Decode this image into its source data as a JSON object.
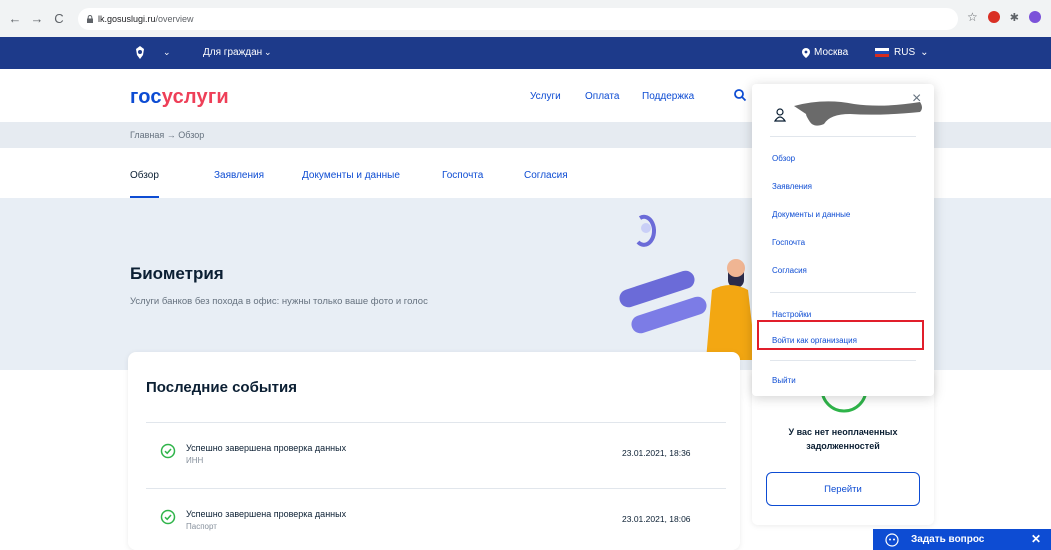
{
  "browser": {
    "url_host": "lk.gosuslugi.ru",
    "url_path": "/overview",
    "back": "←",
    "forward": "→",
    "reload": "C"
  },
  "topbar": {
    "citizens": "Для граждан",
    "city": "Москва",
    "lang": "RUS"
  },
  "header": {
    "logo_a": "гос",
    "logo_b": "услуги",
    "nav": [
      "Услуги",
      "Оплата",
      "Поддержка"
    ]
  },
  "breadcrumbs": "Главная → Обзор",
  "tabs": [
    "Обзор",
    "Заявления",
    "Документы и данные",
    "Госпочта",
    "Согласия"
  ],
  "hero": {
    "title": "Биометрия",
    "subtitle": "Услуги банков без похода в офис: нужны только ваше фото и голос"
  },
  "events": {
    "title": "Последние события",
    "items": [
      {
        "title": "Успешно завершена проверка данных",
        "sub": "ИНН",
        "date": "23.01.2021, 18:36"
      },
      {
        "title": "Успешно завершена проверка данных",
        "sub": "Паспорт",
        "date": "23.01.2021, 18:06"
      }
    ]
  },
  "debt": {
    "message": "У вас нет неоплаченных задолженностей",
    "button": "Перейти"
  },
  "profile_menu": {
    "close": "×",
    "items": [
      "Обзор",
      "Заявления",
      "Документы и данные",
      "Госпочта",
      "Согласия"
    ],
    "settings": "Настройки",
    "login_org": "Войти как организация",
    "logout": "Выйти"
  },
  "chat": {
    "label": "Задать вопрос",
    "close": "✕"
  },
  "colors": {
    "brand_blue": "#0d4cd3",
    "brand_red": "#ee3f58",
    "topbar": "#1d3a8a",
    "highlight": "#e11e2b"
  }
}
